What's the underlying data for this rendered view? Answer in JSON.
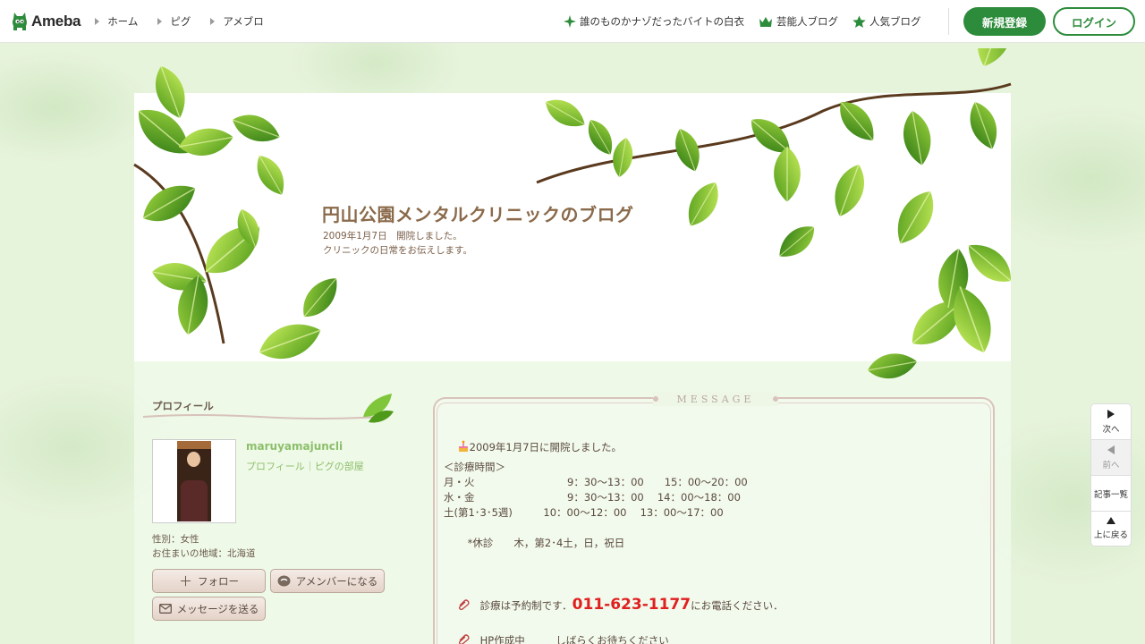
{
  "header": {
    "logo_text": "Ameba",
    "nav": [
      {
        "label": "ホーム"
      },
      {
        "label": "ピグ"
      },
      {
        "label": "アメブロ"
      }
    ],
    "right_links": [
      {
        "label": "誰のものかナゾだったバイトの白衣",
        "icon": "sparkle-icon"
      },
      {
        "label": "芸能人ブログ",
        "icon": "crown-icon"
      },
      {
        "label": "人気ブログ",
        "icon": "star-icon"
      }
    ],
    "register_label": "新規登録",
    "login_label": "ログイン"
  },
  "blog": {
    "title": "円山公園メンタルクリニックのブログ",
    "description_line1": "2009年1月7日　開院しました。",
    "description_line2": "クリニックの日常をお伝えします。"
  },
  "profile": {
    "heading": "プロフィール",
    "username": "maruyamajuncli",
    "links": "プロフィール｜ピグの部屋",
    "gender": "性別：女性",
    "region": "お住まいの地域：北海道",
    "follow_label": "フォロー",
    "amember_label": "アメンバーになる",
    "message_label": "メッセージを送る"
  },
  "message": {
    "title": "MESSAGE",
    "lines": {
      "opened": "2009年1月7日に開院しました。",
      "hours_heading": "＜診療時間＞",
      "mon_tue": "月・火　　　　　　　　　9：30～13：00　　15：00～20：00",
      "wed_fri": "水・金　　　　　　　　　9：30～13：00　 14：00～18：00",
      "sat": "土(第1･3･5週)　　　10：00～12：00　 13：00～17：00",
      "closed": "　　 *休診　　木，第2･4土，日，祝日",
      "reservation_pre": "診療は予約制です．",
      "phone": "011-623-1177",
      "reservation_post": "にお電話ください．",
      "hp": "HP作成中　　　しばらくお待ちください"
    }
  },
  "sidenav": {
    "next": "次へ",
    "prev": "前へ",
    "list": "記事一覧",
    "top": "上に戻る"
  },
  "colors": {
    "brand_green": "#2d8c3c",
    "title_brown": "#8a6a4a",
    "phone_red": "#e02020"
  }
}
